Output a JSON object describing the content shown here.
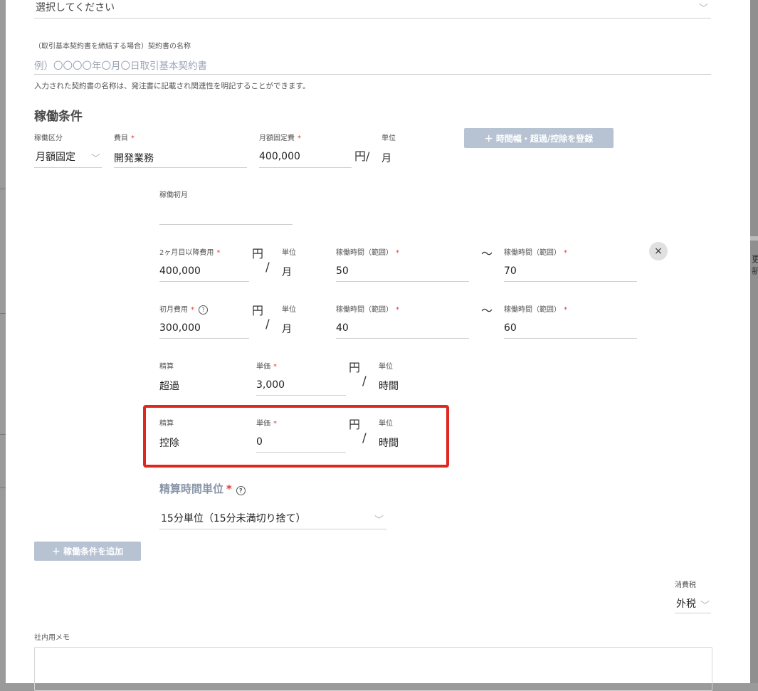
{
  "top_select": {
    "placeholder": "選択してください"
  },
  "contract_name": {
    "label": "（取引基本契約書を締結する場合）契約書の名称",
    "placeholder": "例）〇〇〇〇年〇月〇日取引基本契約書",
    "note": "入力された契約書の名称は、発注書に記載され関連性を明記することができます。"
  },
  "section_title": "稼働条件",
  "row1": {
    "kind_label": "稼働区分",
    "kind_value": "月額固定",
    "item_label": "費目",
    "item_value": "開発業務",
    "fee_label": "月額固定費",
    "fee_value": "400,000",
    "yen_slash": "円/",
    "unit_label": "単位",
    "unit_value": "月",
    "register_button": "＋ 時間幅・超過/控除を登録"
  },
  "start_month": {
    "label": "稼働初月",
    "value": ""
  },
  "row_second": {
    "fee_label": "2ヶ月目以降費用",
    "fee_value": "400,000",
    "yen": "円",
    "unit_label": "単位",
    "unit_value": "月",
    "range1_label": "稼働時間（範囲）",
    "range1_value": "50",
    "tilde": "〜",
    "range2_label": "稼働時間（範囲）",
    "range2_value": "70",
    "close": "×"
  },
  "row_first": {
    "fee_label": "初月費用",
    "fee_value": "300,000",
    "yen": "円",
    "unit_label": "単位",
    "unit_value": "月",
    "range1_label": "稼働時間（範囲）",
    "range1_value": "40",
    "tilde": "〜",
    "range2_label": "稼働時間（範囲）",
    "range2_value": "60"
  },
  "settle_over": {
    "label": "精算",
    "value": "超過",
    "price_label": "単価",
    "price_value": "3,000",
    "yen": "円",
    "unit_label": "単位",
    "unit_value": "時間"
  },
  "settle_deduct": {
    "label": "精算",
    "value": "控除",
    "price_label": "単価",
    "price_value": "0",
    "yen": "円",
    "unit_label": "単位",
    "unit_value": "時間"
  },
  "settle_time_unit": {
    "title": "精算時間単位",
    "value": "15分単位（15分未満切り捨て）"
  },
  "add_condition_button": "＋ 稼働条件を追加",
  "tax": {
    "label": "消費税",
    "value": "外税"
  },
  "memo": {
    "label": "社内用メモ",
    "value": ""
  },
  "required_mark": "*",
  "help_glyph": "?",
  "slash": "/",
  "chevron": "﹀",
  "background_snippet": "更新",
  "colors": {
    "accent_button": "#b7c3d3",
    "required": "#e53935",
    "highlight": "#e0271d"
  }
}
